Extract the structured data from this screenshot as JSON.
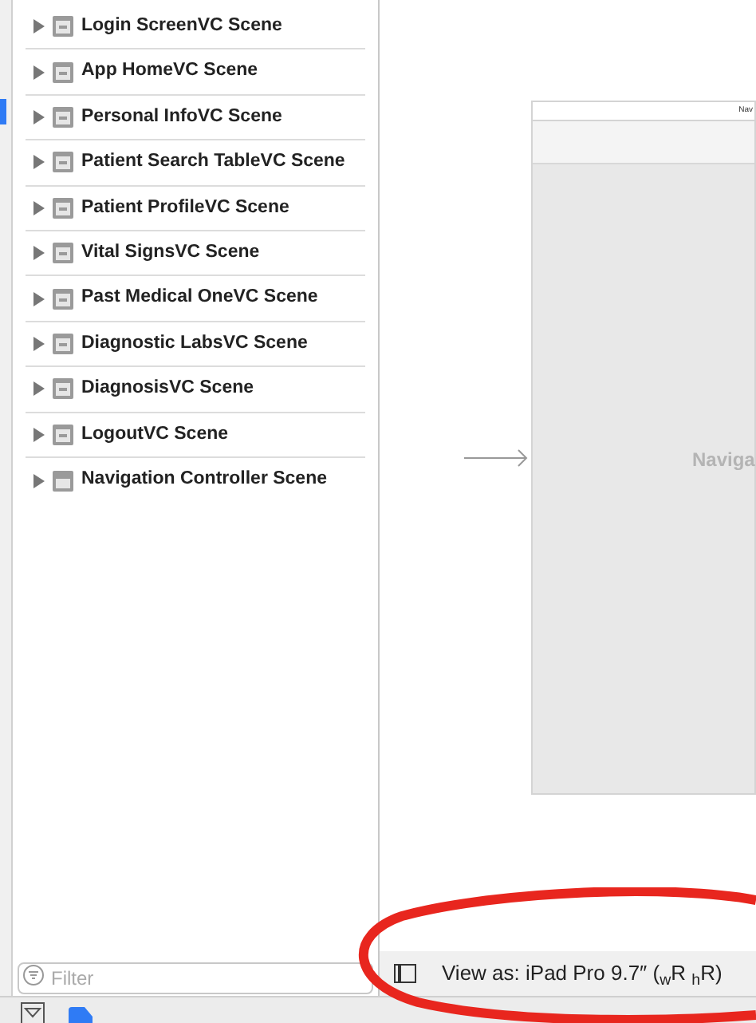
{
  "outline": {
    "items": [
      {
        "label": "Login ScreenVC Scene",
        "expanded": false,
        "kind": "scene"
      },
      {
        "label": "App HomeVC Scene",
        "expanded": false,
        "kind": "scene"
      },
      {
        "label": "Personal InfoVC Scene",
        "expanded": false,
        "kind": "scene"
      },
      {
        "label": "Patient Search TableVC Scene",
        "expanded": false,
        "kind": "scene"
      },
      {
        "label": "Patient ProfileVC Scene",
        "expanded": false,
        "kind": "scene"
      },
      {
        "label": "Vital SignsVC Scene",
        "expanded": false,
        "kind": "scene"
      },
      {
        "label": "Past Medical OneVC Scene",
        "expanded": false,
        "kind": "scene"
      },
      {
        "label": "Diagnostic LabsVC Scene",
        "expanded": false,
        "kind": "scene"
      },
      {
        "label": "DiagnosisVC Scene",
        "expanded": false,
        "kind": "scene"
      },
      {
        "label": "LogoutVC Scene",
        "expanded": false,
        "kind": "scene"
      },
      {
        "label": "Navigation Controller Scene",
        "expanded": false,
        "kind": "navigation"
      }
    ]
  },
  "filter": {
    "placeholder": "Filter"
  },
  "canvas": {
    "scene": {
      "title": "Nav",
      "label": "Naviga"
    }
  },
  "view_as": "View as: iPad Pro 9.7″ ($_{w}$R $_{h}$R)"
}
